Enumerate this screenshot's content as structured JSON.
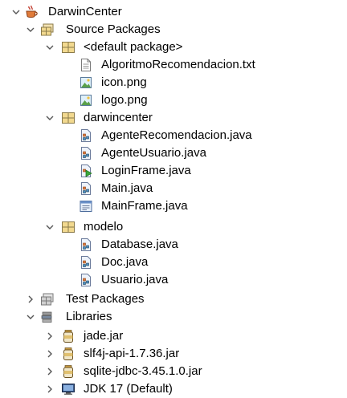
{
  "tree": {
    "project": {
      "label": "DarwinCenter",
      "icon": "java-project-icon"
    },
    "source_packages": {
      "label": "Source Packages",
      "icon": "source-packages-icon"
    },
    "default_package": {
      "label": "<default package>",
      "icon": "package-icon"
    },
    "default_files": [
      {
        "label": "AlgoritmoRecomendacion.txt",
        "icon": "text-file-icon"
      },
      {
        "label": "icon.png",
        "icon": "image-file-icon"
      },
      {
        "label": "logo.png",
        "icon": "image-file-icon"
      }
    ],
    "darwincenter_package": {
      "label": "darwincenter",
      "icon": "package-icon"
    },
    "darwincenter_files": [
      {
        "label": "AgenteRecomendacion.java",
        "icon": "java-class-icon"
      },
      {
        "label": "AgenteUsuario.java",
        "icon": "java-class-icon"
      },
      {
        "label": "LoginFrame.java",
        "icon": "java-main-class-icon"
      },
      {
        "label": "Main.java",
        "icon": "java-class-icon"
      },
      {
        "label": "MainFrame.java",
        "icon": "java-form-icon"
      }
    ],
    "modelo_package": {
      "label": "modelo",
      "icon": "package-icon"
    },
    "modelo_files": [
      {
        "label": "Database.java",
        "icon": "java-class-icon"
      },
      {
        "label": "Doc.java",
        "icon": "java-class-icon"
      },
      {
        "label": "Usuario.java",
        "icon": "java-class-icon"
      }
    ],
    "test_packages": {
      "label": "Test Packages",
      "icon": "test-packages-icon"
    },
    "libraries": {
      "label": "Libraries",
      "icon": "libraries-icon"
    },
    "library_items": [
      {
        "label": "jade.jar",
        "icon": "jar-icon"
      },
      {
        "label": "slf4j-api-1.7.36.jar",
        "icon": "jar-icon"
      },
      {
        "label": "sqlite-jdbc-3.45.1.0.jar",
        "icon": "jar-icon"
      },
      {
        "label": "JDK 17 (Default)",
        "icon": "jdk-icon"
      }
    ]
  }
}
